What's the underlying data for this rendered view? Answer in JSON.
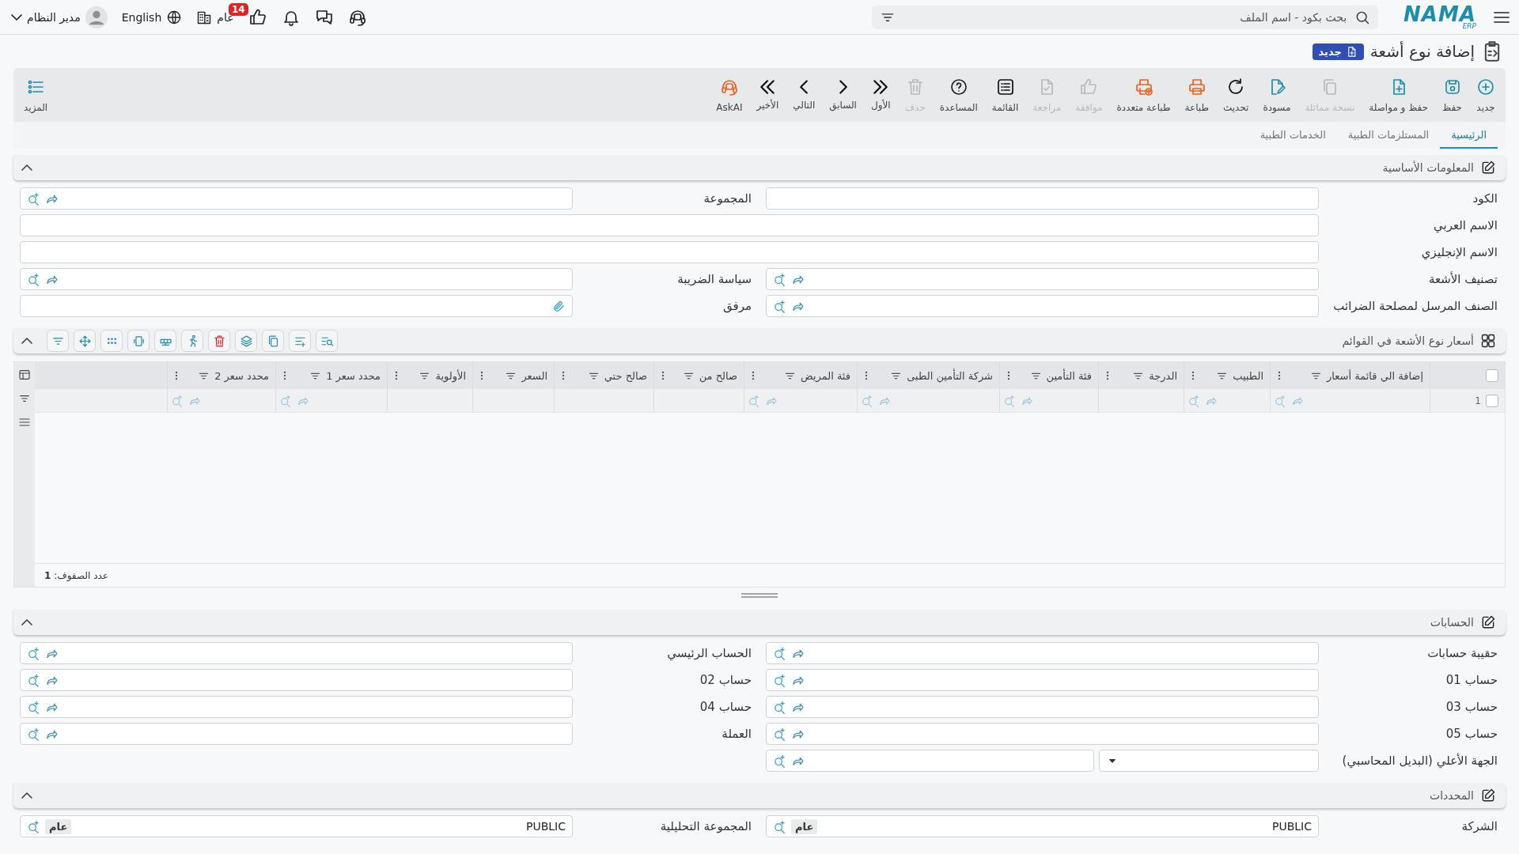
{
  "topbar": {
    "logo": "NAMA",
    "logo_sub": "ERP",
    "search": {
      "placeholder": "بحث بكود - اسم الملف"
    },
    "notification_count": "14",
    "company": "عام",
    "language": "English",
    "user": "مدير النظام"
  },
  "page": {
    "title": "إضافة نوع أشعة",
    "status": "جديد"
  },
  "toolbar": [
    {
      "label": "جديد",
      "disabled": false
    },
    {
      "label": "حفظ",
      "disabled": false
    },
    {
      "label": "حفظ و مواصلة",
      "disabled": false
    },
    {
      "label": "نسخة مماثلة",
      "disabled": true
    },
    {
      "label": "مسودة",
      "disabled": false
    },
    {
      "label": "تحديث",
      "disabled": false
    },
    {
      "label": "طباعة",
      "disabled": false
    },
    {
      "label": "طباعة متعددة",
      "disabled": false
    },
    {
      "label": "موافقة",
      "disabled": true
    },
    {
      "label": "مراجعة",
      "disabled": true
    },
    {
      "label": "القائمة",
      "disabled": false
    },
    {
      "label": "المساعدة",
      "disabled": false
    },
    {
      "label": "حذف",
      "disabled": true
    },
    {
      "label": "الأول",
      "disabled": false
    },
    {
      "label": "السابق",
      "disabled": false
    },
    {
      "label": "التالي",
      "disabled": false
    },
    {
      "label": "الأخير",
      "disabled": false
    },
    {
      "label": "AskAI",
      "disabled": false
    }
  ],
  "more": {
    "label": "المزيد"
  },
  "tabs": [
    {
      "label": "الرئيسية",
      "selected": true
    },
    {
      "label": "المستلزمات الطبية",
      "selected": false
    },
    {
      "label": "الخدمات الطبية",
      "selected": false
    }
  ],
  "sections": [
    {
      "kind": "form",
      "title": "المعلومات الأساسية",
      "expanded": true,
      "rows": [
        [
          {
            "label": "الكود",
            "kind": "text"
          },
          {
            "label": "المجموعة",
            "kind": "lookup"
          }
        ],
        [
          {
            "label": "الاسم العربي",
            "kind": "long-text"
          }
        ],
        [
          {
            "label": "الاسم الإنجليزي",
            "kind": "long-text"
          }
        ],
        [
          {
            "label": "تصنيف الأشعة",
            "kind": "lookup"
          },
          {
            "label": "سياسة الضريبة",
            "kind": "lookup"
          }
        ],
        [
          {
            "label": "الصنف المرسل لمصلحة الضرائب",
            "kind": "lookup"
          },
          {
            "label": "مرفق",
            "kind": "attach"
          }
        ]
      ]
    },
    {
      "kind": "grid",
      "title": "أسعار نوع الأشعة في القوائم",
      "expanded": true,
      "all_checked": false,
      "columns": [
        {
          "label": "إضافة الي قائمة أسعار",
          "lookup": true
        },
        {
          "label": "الطبيب",
          "lookup": true
        },
        {
          "label": "الدرجة",
          "lookup": false
        },
        {
          "label": "فئة التأمين",
          "lookup": true
        },
        {
          "label": "شركة التأمين الطبى",
          "lookup": true
        },
        {
          "label": "فئة المريض",
          "lookup": true
        },
        {
          "label": "صالح من",
          "lookup": false
        },
        {
          "label": "صالح حتي",
          "lookup": false
        },
        {
          "label": "السعر",
          "lookup": false
        },
        {
          "label": "الأولوية",
          "lookup": false
        },
        {
          "label": "محدد سعر 1",
          "lookup": true
        },
        {
          "label": "محدد سعر 2",
          "lookup": true
        }
      ],
      "rows": [
        {
          "number": "1",
          "checked": false
        }
      ],
      "row_count_text": "عدد الصفوف: **1**"
    },
    {
      "kind": "form",
      "title": "الحسابات",
      "expanded": true,
      "rows": [
        [
          {
            "label": "حقيبة حسابات",
            "kind": "lookup"
          },
          {
            "label": "الحساب الرئيسي",
            "kind": "lookup"
          }
        ],
        [
          {
            "label": "حساب 01",
            "kind": "lookup"
          },
          {
            "label": "حساب 02",
            "kind": "lookup"
          }
        ],
        [
          {
            "label": "حساب 03",
            "kind": "lookup"
          },
          {
            "label": "حساب 04",
            "kind": "lookup"
          }
        ],
        [
          {
            "label": "حساب 05",
            "kind": "lookup"
          },
          {
            "label": "العملة",
            "kind": "lookup"
          }
        ],
        [
          {
            "label": "الجهة الأعلي (البديل المحاسبي)",
            "kind": "combo"
          }
        ]
      ]
    },
    {
      "kind": "form",
      "title": "المحددات",
      "expanded": true,
      "rows": [
        [
          {
            "label": "الشركة",
            "kind": "lookup",
            "value": "PUBLIC",
            "tag": "عام"
          },
          {
            "label": "المجموعة التحليلية",
            "kind": "lookup",
            "value": "PUBLIC",
            "tag": "عام"
          }
        ]
      ]
    }
  ]
}
